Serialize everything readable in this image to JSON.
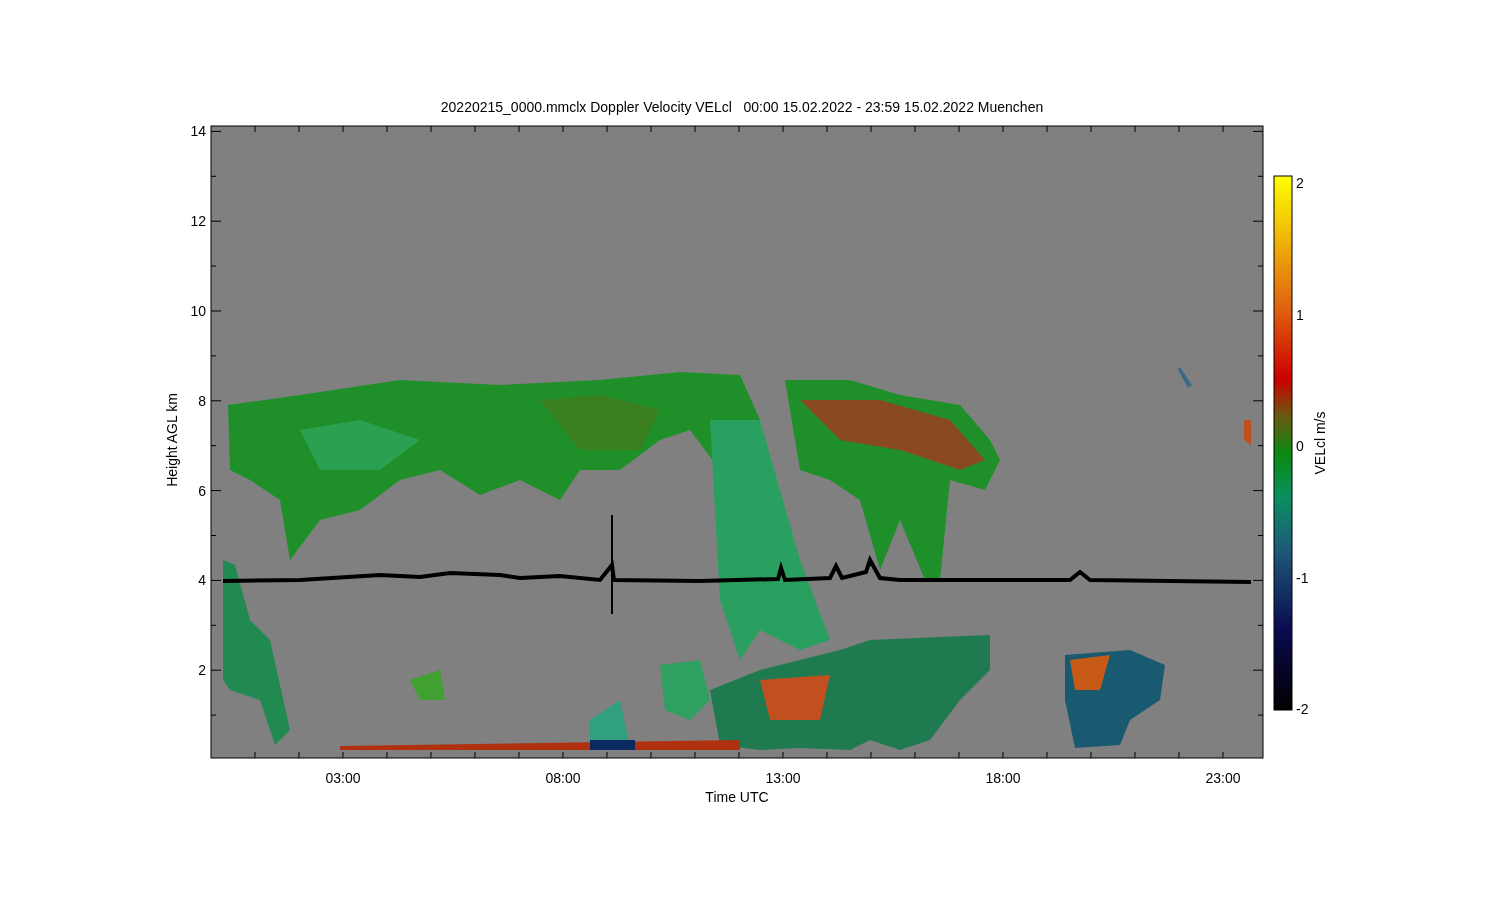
{
  "title": "20220215_0000.mmclx Doppler Velocity VELcl   00:00 15.02.2022 - 23:59 15.02.2022 Muenchen",
  "y_axis": {
    "label": "Height AGL km",
    "ticks": [
      "14",
      "12",
      "10",
      "8",
      "6",
      "4",
      "2"
    ]
  },
  "x_axis": {
    "label": "Time UTC",
    "ticks": [
      "03:00",
      "08:00",
      "13:00",
      "18:00",
      "23:00"
    ]
  },
  "colorbar": {
    "label": "VELcl m/s",
    "ticks": [
      "2",
      "1",
      "0",
      "-1",
      "-2"
    ]
  }
}
